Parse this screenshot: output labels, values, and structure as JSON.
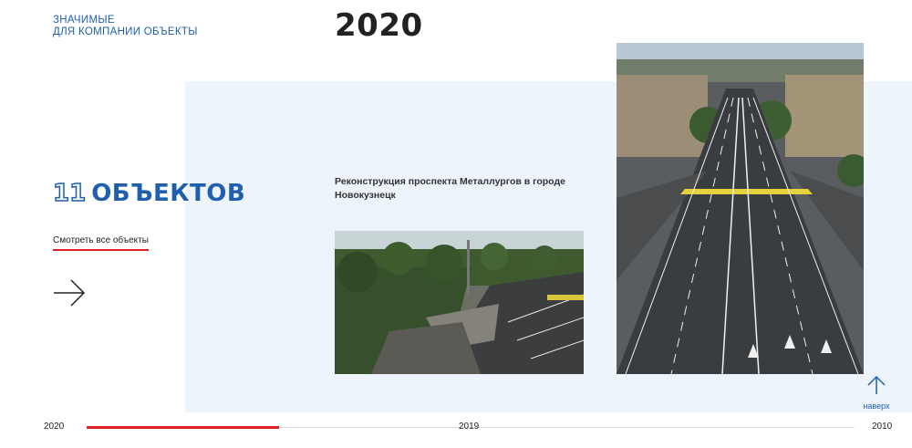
{
  "section": {
    "title_line1": "ЗНАЧИМЫЕ",
    "title_line2": "ДЛЯ КОМПАНИИ ОБЪЕКТЫ"
  },
  "year": "2020",
  "objects": {
    "count": "11",
    "word": "ОБЪЕКТОВ",
    "view_all_label": "Смотреть все объекты"
  },
  "project": {
    "title": "Реконструкция проспекта Металлургов в городе Новокузнецк"
  },
  "scroll_top": {
    "label": "наверх",
    "icon": "arrow-up-icon"
  },
  "timeline": {
    "start_year": "2020",
    "mid_year": "2019",
    "end_year": "2010",
    "progress": 0.25
  },
  "colors": {
    "accent_blue": "#1f5fad",
    "accent_red": "#e21f26",
    "panel_bg": "#eef4fb"
  }
}
